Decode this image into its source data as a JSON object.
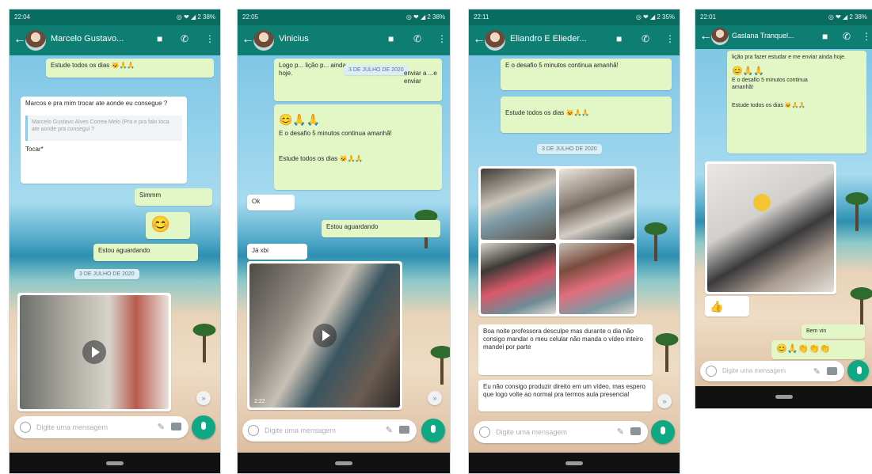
{
  "phones": [
    {
      "status_time": "22:04",
      "status_right": "◎ ❤ ◢ 2 38%",
      "contact": "Marcelo Gustavo...",
      "messages": {
        "m1": "Estude todos os dias 🐱🙏🙏",
        "m2": "Marcos e pra mim trocar ate aonde eu consegue ?",
        "m2_quote": "Marcelo Gustavo Alves Correa Melo (Pra e pra falo toca ate aonde pra consegui ?",
        "m2_tail": "Tocar*",
        "m3": "Simmm",
        "m4": "😊",
        "m5": "Estou aguardando",
        "date": "3 DE JULHO DE 2020"
      },
      "input_placeholder": "Digite uma mensagem"
    },
    {
      "status_time": "22:05",
      "status_right": "◎ ❤ ◢ 2 38%",
      "contact": "Vinicius",
      "messages": {
        "m1": "Logo p... lição p... ainda hoje.",
        "m1_date": "3 DE JULHO DE 2020",
        "m1_tail": "enviar a ...e enviar",
        "m2": "😊🙏🙏",
        "m3": "E o desafio 5 minutos continua amanhã!",
        "m4": "Estude todos os dias 🐱🙏🙏",
        "m5": "Ok",
        "m6": "Estou aguardando",
        "m7": "Já xbi",
        "video_duration": "2:22"
      },
      "input_placeholder": "Digite uma mensagem"
    },
    {
      "status_time": "22:11",
      "status_right": "◎ ❤ ◢ 2 35%",
      "contact": "Eliandro E Elieder...",
      "messages": {
        "m1": "E o desafio 5 minutos continua amanhã!",
        "m2": "Estude todos os dias 🐱🙏🙏",
        "date": "3 DE JULHO DE 2020",
        "m3": "Boa noite professora desculpe mas durante o dia não consigo mandar o meu celular não manda o vídeo inteiro mandei por parte",
        "m4": "Eu não consigo produzir direito em um vídeo, mas espero que logo volte ao normal pra termos aula presencial"
      },
      "input_placeholder": "Digite uma mensagem"
    },
    {
      "status_time": "22:01",
      "status_right": "◎ ❤ ◢ 2 38%",
      "contact": "Gaslana Tranquel...",
      "messages": {
        "m1": "lição pra fazer estudar e me enviar ainda hoje.",
        "m2": "😊🙏🙏",
        "m3": "E o desafio 5 minutos continua amanhã!",
        "m4": "Estude todos os dias 🐱🙏🙏",
        "m5": "👍",
        "m6": "Bem vin",
        "m7": "😊🙏👏👏👏"
      },
      "input_placeholder": "Digite uma mensagem"
    }
  ]
}
